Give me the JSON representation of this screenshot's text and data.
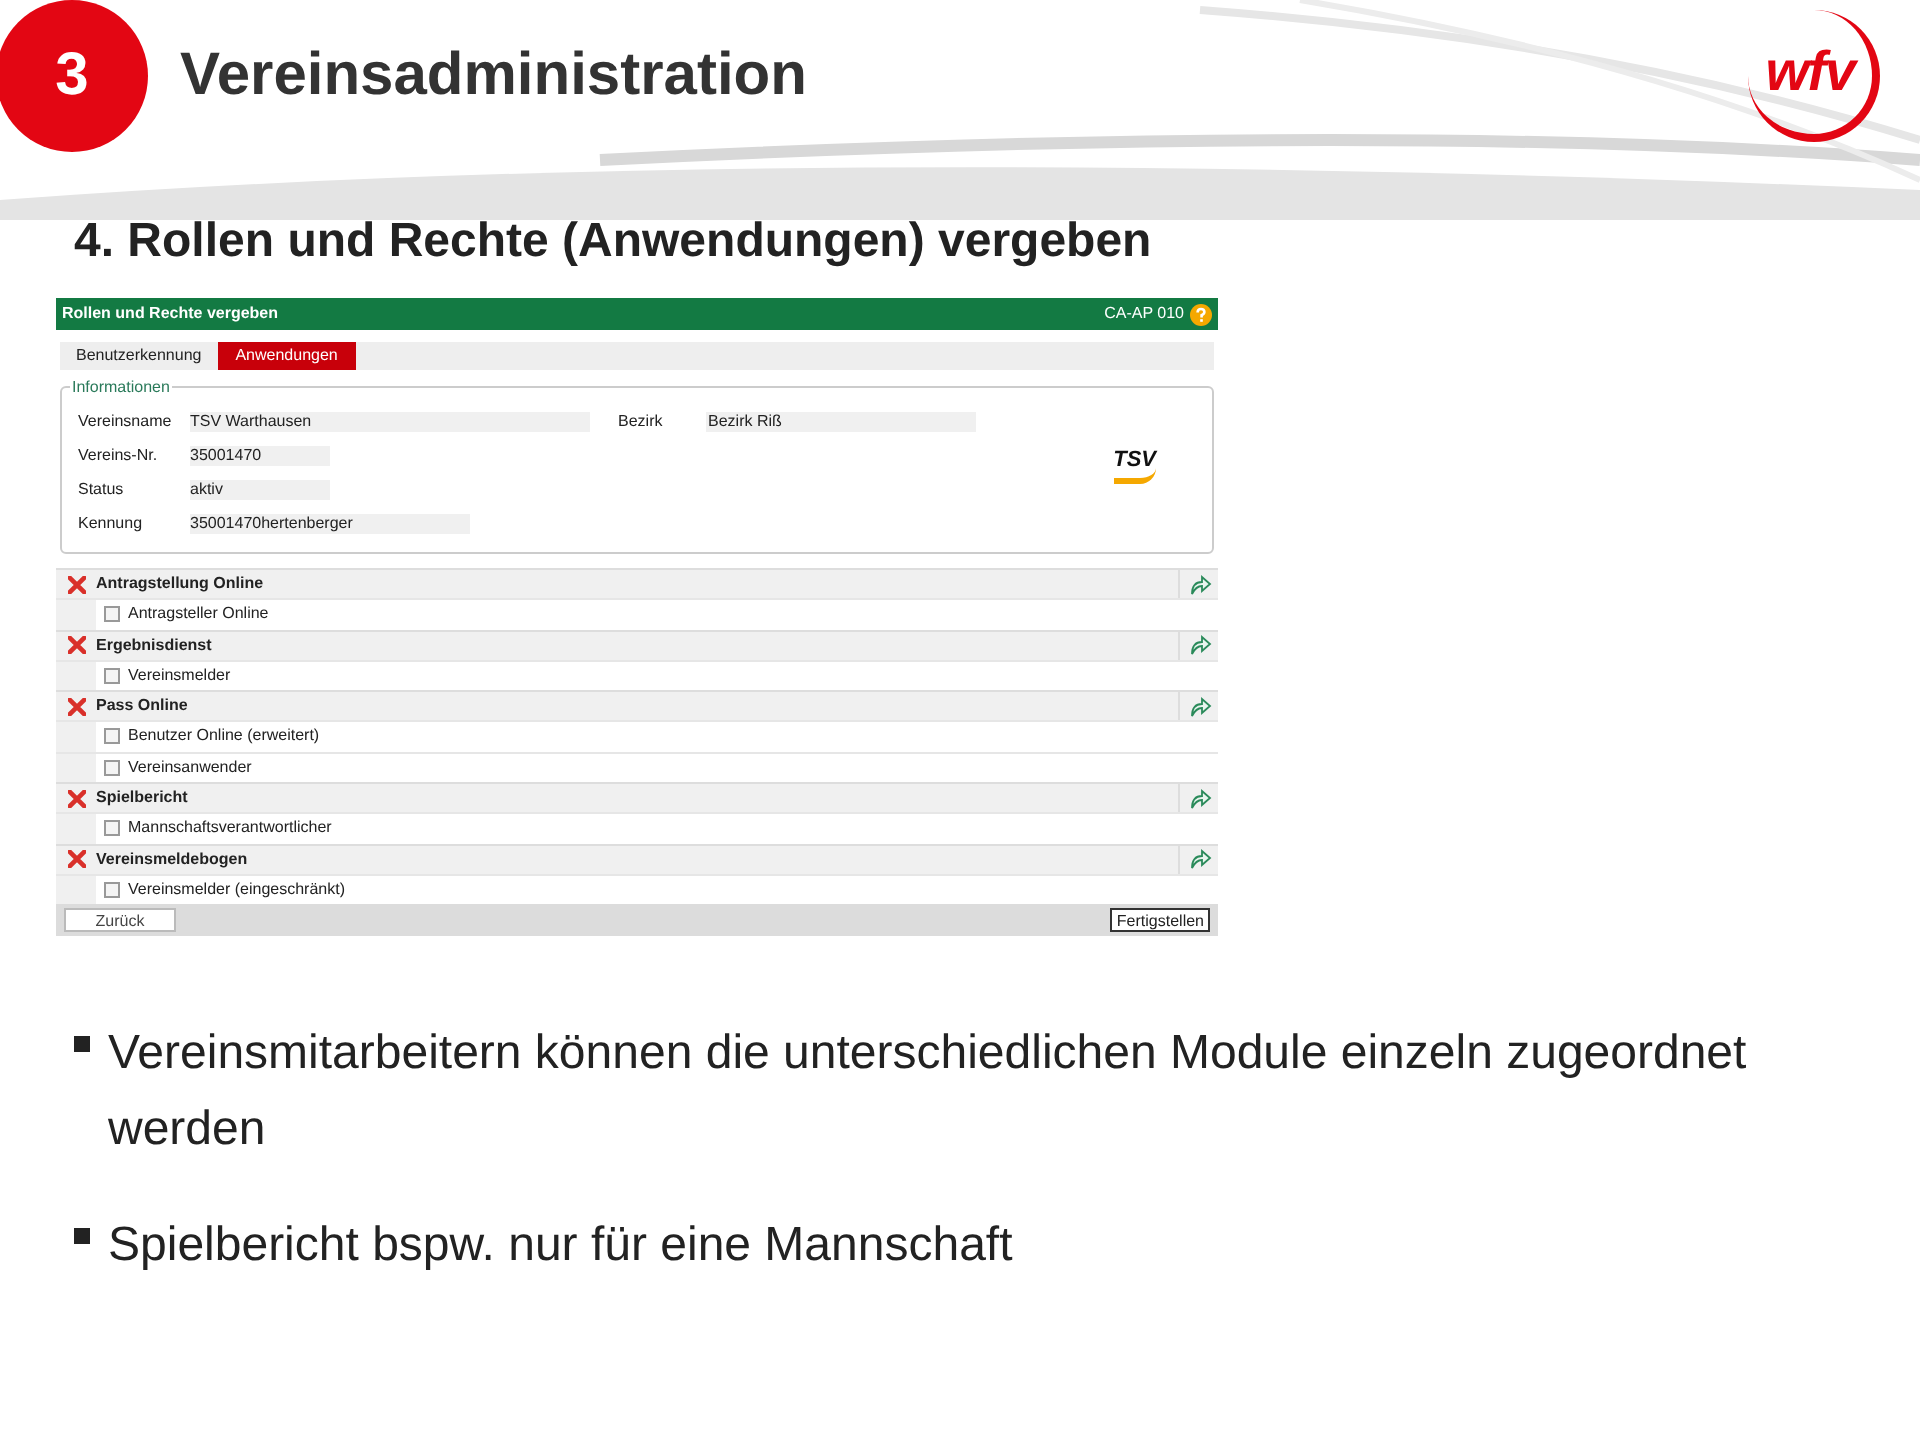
{
  "header": {
    "badge": "3",
    "title": "Vereinsadministration",
    "logo": "wfv"
  },
  "heading": "4. Rollen und Rechte (Anwendungen) vergeben",
  "app": {
    "title": "Rollen und Rechte vergeben",
    "code": "CA-AP 010",
    "tabs": [
      {
        "label": "Benutzerkennung",
        "selected": false
      },
      {
        "label": "Anwendungen",
        "selected": true
      }
    ],
    "info": {
      "legend": "Informationen",
      "left": [
        {
          "label": "Vereinsname",
          "value": "TSV Warthausen"
        },
        {
          "label": "Vereins-Nr.",
          "value": "35001470"
        },
        {
          "label": "Status",
          "value": "aktiv"
        },
        {
          "label": "Kennung",
          "value": "35001470hertenberger"
        }
      ],
      "right": [
        {
          "label": "Bezirk",
          "value": "Bezirk Riß"
        }
      ],
      "logo": "TSV"
    },
    "sections": [
      {
        "title": "Antragstellung Online",
        "items": [
          {
            "label": "Antragsteller Online",
            "checked": false
          }
        ]
      },
      {
        "title": "Ergebnisdienst",
        "items": [
          {
            "label": "Vereinsmelder",
            "checked": false
          }
        ]
      },
      {
        "title": "Pass Online",
        "items": [
          {
            "label": "Benutzer Online (erweitert)",
            "checked": false
          },
          {
            "label": "Vereinsanwender",
            "checked": false
          }
        ]
      },
      {
        "title": "Spielbericht",
        "items": [
          {
            "label": "Mannschaftsverantwortlicher",
            "checked": false
          }
        ]
      },
      {
        "title": "Vereinsmeldebogen",
        "items": [
          {
            "label": "Vereinsmelder (eingeschränkt)",
            "checked": false
          }
        ]
      }
    ],
    "buttons": [
      {
        "label": "Zurück",
        "default": false
      },
      {
        "label": "Fertigstellen",
        "default": true
      }
    ]
  },
  "bullets": [
    "Vereinsmitarbeitern können die unterschiedlichen Module einzeln zugeordnet werden",
    "Spielbericht bspw. nur für eine Mannschaft"
  ]
}
